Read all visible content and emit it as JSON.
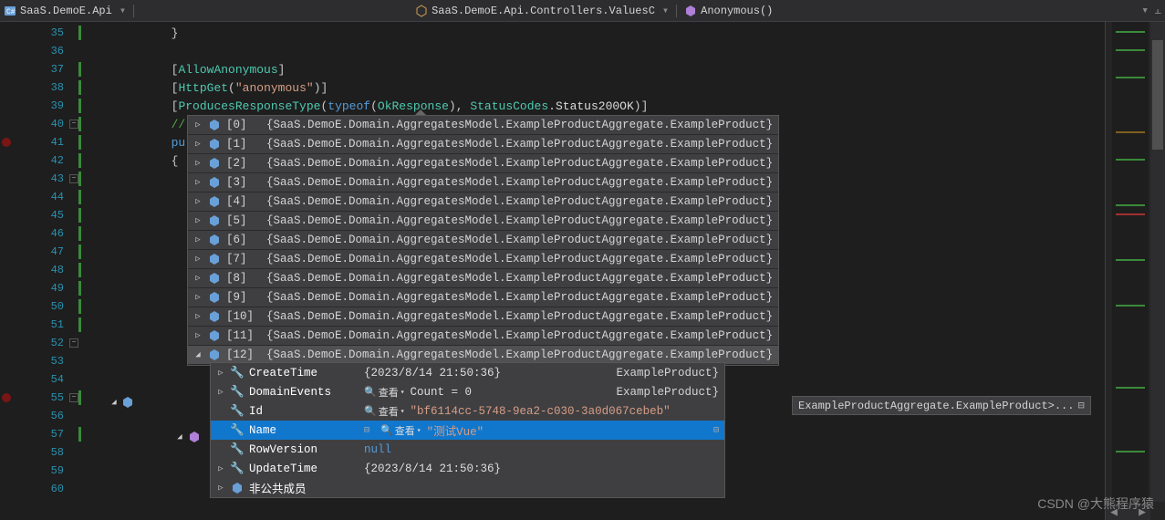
{
  "breadcrumbs": {
    "project": "SaaS.DemoE.Api",
    "class": "SaaS.DemoE.Api.Controllers.ValuesC",
    "method": "Anonymous()"
  },
  "code": {
    "lines": [
      "35",
      "36",
      "37",
      "38",
      "39",
      "40",
      "41",
      "42",
      "43",
      "44",
      "45",
      "46",
      "47",
      "48",
      "49",
      "50",
      "51",
      "52",
      "53",
      "54",
      "55",
      "56",
      "57",
      "58",
      "59",
      "60"
    ],
    "l35": "}",
    "l37_attr": "AllowAnonymous",
    "l38_attr": "HttpGet",
    "l38_str": "\"anonymous\"",
    "l39_attr": "ProducesResponseType",
    "l39_typeof": "typeof",
    "l39_ok": "OkResponse",
    "l39_sc": "StatusCodes",
    "l39_status": "Status200OK",
    "l40_comment": "//",
    "l41_pub": "pu"
  },
  "collection_type": "{SaaS.DemoE.Domain.AggregatesModel.ExampleProductAggregate.ExampleProduct}",
  "items": [
    {
      "idx": "[0]"
    },
    {
      "idx": "[1]"
    },
    {
      "idx": "[2]"
    },
    {
      "idx": "[3]"
    },
    {
      "idx": "[4]"
    },
    {
      "idx": "[5]"
    },
    {
      "idx": "[6]"
    },
    {
      "idx": "[7]"
    },
    {
      "idx": "[8]"
    },
    {
      "idx": "[9]"
    },
    {
      "idx": "[10]"
    },
    {
      "idx": "[11]"
    },
    {
      "idx": "[12]"
    }
  ],
  "inline_hint": "ExampleProductAggregate.ExampleProduct>...",
  "props": {
    "CreateTime": {
      "label": "CreateTime",
      "value": "{2023/8/14 21:50:36}"
    },
    "DomainEvents": {
      "label": "DomainEvents",
      "value": "Count = 0"
    },
    "Id": {
      "label": "Id",
      "value": "\"bf6114cc-5748-9ea2-c030-3a0d067cebeb\""
    },
    "Name": {
      "label": "Name",
      "value": "\"测试Vue\""
    },
    "RowVersion": {
      "label": "RowVersion",
      "value": "null"
    },
    "UpdateTime": {
      "label": "UpdateTime",
      "value": "{2023/8/14 21:50:36}"
    },
    "NonPublic": {
      "label": "非公共成员"
    }
  },
  "lookup_label": "查看",
  "trailing_hints": {
    "row1": "ExampleProduct}",
    "row2": "ExampleProduct}"
  },
  "watermark": "CSDN @大熊程序猿"
}
